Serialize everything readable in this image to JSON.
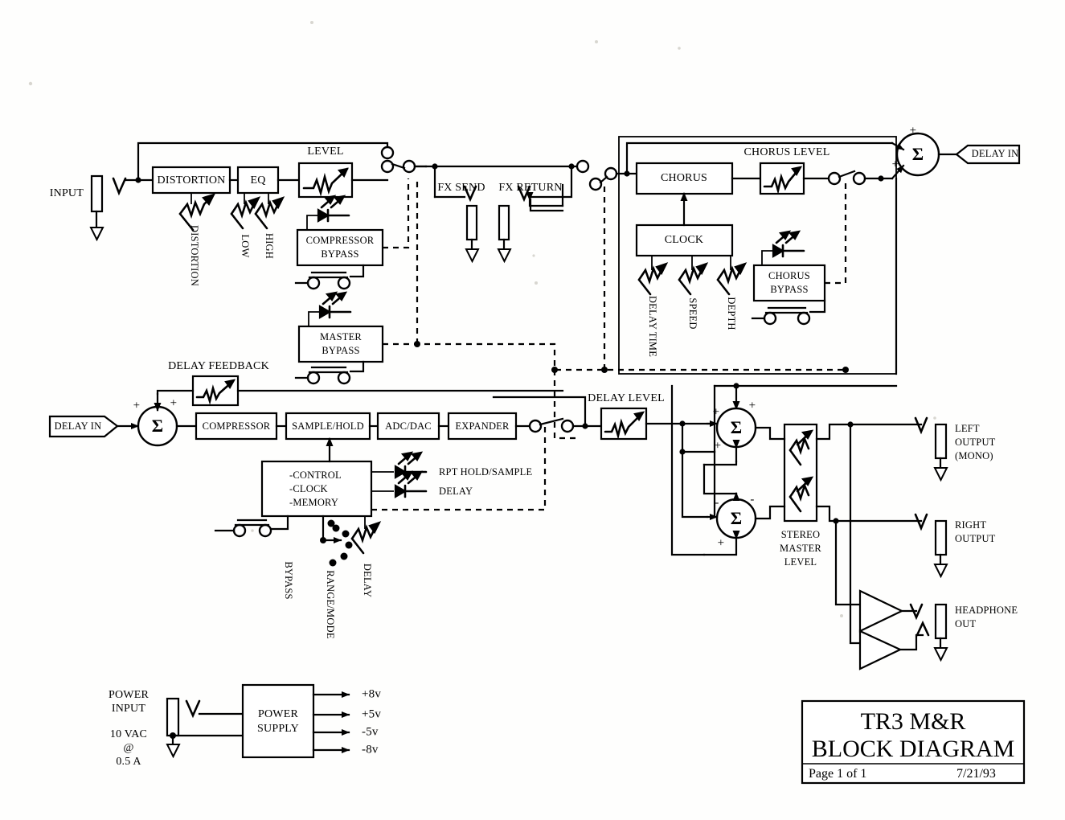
{
  "document": {
    "title_line1": "TR3 M&R",
    "title_line2": "BLOCK DIAGRAM",
    "page": "Page 1 of 1",
    "date": "7/21/93"
  },
  "io": {
    "input_jack": "INPUT",
    "fx_send": "FX SEND",
    "fx_return": "FX RETURN",
    "delay_in_out_flag": "DELAY IN",
    "delay_in_flag": "DELAY IN",
    "left_output": "LEFT\nOUTPUT\n(MONO)",
    "left_output_l1": "LEFT",
    "left_output_l2": "OUTPUT",
    "left_output_l3": "(MONO)",
    "right_output_l1": "RIGHT",
    "right_output_l2": "OUTPUT",
    "headphone_l1": "HEADPHONE",
    "headphone_l2": "OUT"
  },
  "preamp": {
    "distortion_block": "DISTORTION",
    "eq_block": "EQ",
    "level_pot": "LEVEL",
    "distortion_pot": "DISTORTION",
    "low_pot": "LOW",
    "high_pot": "HIGH",
    "compressor_bypass_l1": "COMPRESSOR",
    "compressor_bypass_l2": "BYPASS",
    "master_bypass_l1": "MASTER",
    "master_bypass_l2": "BYPASS"
  },
  "chorus": {
    "chorus_block": "CHORUS",
    "clock_block": "CLOCK",
    "chorus_level_pot": "CHORUS LEVEL",
    "delay_time_pot": "DELAY TIME",
    "speed_pot": "SPEED",
    "depth_pot": "DEPTH",
    "chorus_bypass_l1": "CHORUS",
    "chorus_bypass_l2": "BYPASS"
  },
  "delay": {
    "feedback_pot": "DELAY FEEDBACK",
    "compressor_block": "COMPRESSOR",
    "sample_hold_block": "SAMPLE/HOLD",
    "adc_dac_block": "ADC/DAC",
    "expander_block": "EXPANDER",
    "delay_level_pot": "DELAY LEVEL",
    "control_line1": "-CONTROL",
    "control_line2": "-CLOCK",
    "control_line3": "-MEMORY",
    "led_rpt": "RPT HOLD/SAMPLE",
    "led_delay": "DELAY",
    "bypass_switch": "BYPASS",
    "range_mode_switch": "RANGE/MODE",
    "delay_pot": "DELAY"
  },
  "output": {
    "stereo_master_l1": "STEREO",
    "stereo_master_l2": "MASTER",
    "stereo_master_l3": "LEVEL",
    "plus": "+",
    "minus": "-"
  },
  "power": {
    "input_l1": "POWER",
    "input_l2": "INPUT",
    "spec_l1": "10 VAC",
    "spec_l2": "@",
    "spec_l3": "0.5 A",
    "supply_l1": "POWER",
    "supply_l2": "SUPPLY",
    "rail1": "+8v",
    "rail2": "+5v",
    "rail3": "-5v",
    "rail4": "-8v"
  },
  "colors": {
    "ink": "#000000",
    "paper": "#fefefd"
  }
}
